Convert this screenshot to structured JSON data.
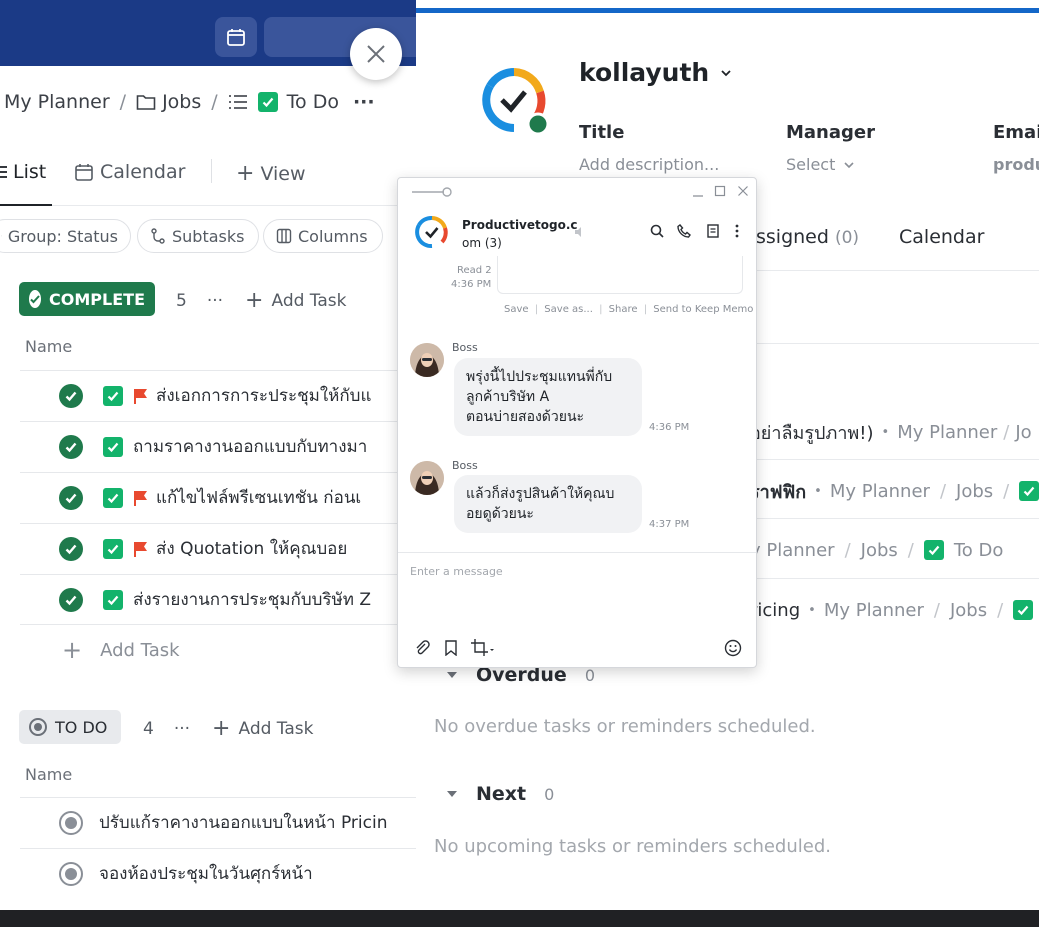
{
  "left": {
    "breadcrumb": {
      "planner": "My Planner",
      "jobs": "Jobs",
      "todo": "To Do",
      "more": "···"
    },
    "views": {
      "list": "List",
      "calendar": "Calendar",
      "view": "View",
      "plus": "+"
    },
    "filters": {
      "group": "Group: Status",
      "subtasks": "Subtasks",
      "columns": "Columns"
    },
    "complete_group": {
      "label": "COMPLETE",
      "count": "5",
      "more": "···",
      "add": "Add Task",
      "col_name": "Name",
      "tasks": [
        {
          "title": "ส่งเอกการการะประชุมให้กับแ",
          "flag": true
        },
        {
          "title": "ถามราคางานออกแบบกับทางมา",
          "flag": false
        },
        {
          "title": "แก้ไขไฟล์พรีเซนเทชัน ก่อนเ",
          "flag": true
        },
        {
          "title": "ส่ง Quotation ให้คุณบอย",
          "flag": true
        },
        {
          "title": "ส่งรายงานการประชุมกับบริษัท Z",
          "flag": false
        }
      ],
      "add_bottom": "Add Task"
    },
    "todo_group": {
      "label": "TO DO",
      "count": "4",
      "more": "···",
      "add": "Add Task",
      "col_name": "Name",
      "tasks": [
        {
          "title": "ปรับแก้ราคางานออกแบบในหน้า Pricin"
        },
        {
          "title": "จองห้องประชุมในวันศุกร์หน้า"
        }
      ]
    }
  },
  "right": {
    "user": "kollayuth",
    "fields": {
      "title_label": "Title",
      "title_value": "Add description...",
      "manager_label": "Manager",
      "manager_value": "Select",
      "email_label": "Email",
      "email_value": "produ"
    },
    "tabs": {
      "assigned": "ssigned",
      "assigned_count": "(0)",
      "calendar": "Calendar"
    },
    "tasks": [
      {
        "title": "อย่าลืมรูปภาพ!)",
        "sep": "•",
        "planner": "My Planner",
        "slash": "/",
        "jobs": "Jo"
      },
      {
        "title": "ราฟฟิก",
        "sep": "•",
        "planner": "My Planner",
        "slash": "/",
        "jobs": "Jobs",
        "slash2": "/"
      },
      {
        "planner": "y Planner",
        "slash": "/",
        "jobs": "Jobs",
        "slash2": "/",
        "todo": "To Do"
      },
      {
        "title": "ricing",
        "sep": "•",
        "planner": "My Planner",
        "slash": "/",
        "jobs": "Jobs",
        "slash2": "/"
      }
    ],
    "overdue": {
      "label": "Overdue",
      "count": "0",
      "empty": "No overdue tasks or reminders scheduled."
    },
    "next": {
      "label": "Next",
      "count": "0",
      "empty": "No upcoming tasks or reminders scheduled."
    }
  },
  "chat": {
    "title_line1": "Productivetogo.c",
    "title_line2": "om (3)",
    "read_label": "Read 2",
    "read_time": "4:36 PM",
    "actions": {
      "save": "Save",
      "save_as": "Save as...",
      "share": "Share",
      "keep": "Send to Keep Memo",
      "sep": "|"
    },
    "messages": [
      {
        "sender": "Boss",
        "text": [
          "พรุ่งนี้ไปประชุมแทนพี่กับ",
          "ลูกค้าบริษัท A",
          "ตอนบ่ายสองด้วยนะ"
        ],
        "time": "4:36 PM"
      },
      {
        "sender": "Boss",
        "text": [
          "แล้วก็ส่งรูปสินค้าให้คุณบ",
          "อยดูด้วยนะ"
        ],
        "time": "4:37 PM"
      }
    ],
    "input_placeholder": "Enter a message"
  },
  "colors": {
    "accent_blue": "#1467c8",
    "header_navy": "#1b3a86",
    "complete_green": "#1f7a4c",
    "check_green": "#13b36b",
    "flag_red": "#e8492f"
  }
}
